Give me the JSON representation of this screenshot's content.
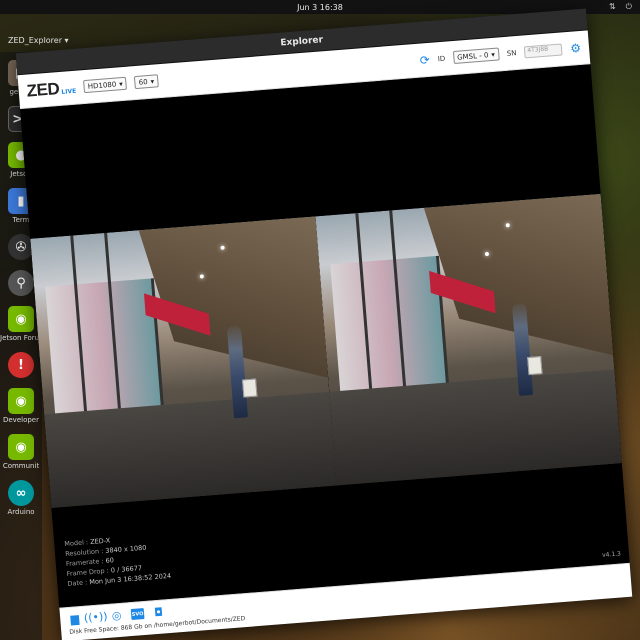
{
  "system": {
    "clock": "Jun 3  16:38",
    "app_menu": "ZED_Explorer"
  },
  "dock": {
    "items": [
      {
        "name": "files-icon",
        "label": "gerbot"
      },
      {
        "name": "terminal-icon",
        "label": ""
      },
      {
        "name": "jetson-icon",
        "label": "Jetson"
      },
      {
        "name": "settings-icon",
        "label": "Term"
      },
      {
        "name": "software-icon",
        "label": ""
      },
      {
        "name": "nvidia-icon",
        "label": "Jetson Forum"
      },
      {
        "name": "updates-icon",
        "label": ""
      },
      {
        "name": "developer-icon",
        "label": "Developer"
      },
      {
        "name": "community-icon",
        "label": "Communit"
      },
      {
        "name": "arduino-icon",
        "label": "Arduino"
      }
    ]
  },
  "window": {
    "title": "Explorer"
  },
  "toolbar": {
    "logo": "ZED",
    "logo_sub": "LIVE",
    "resolution": "HD1080",
    "fps": "60",
    "id_label": "ID",
    "input": "GMSL - 0",
    "sn_label": "SN",
    "sn_value": "4T3J8B"
  },
  "info": {
    "model_key": "Model :",
    "model": "ZED-X",
    "resolution_key": "Resolution :",
    "resolution": "3840 x 1080",
    "framerate_key": "Framerate :",
    "framerate": "60",
    "frame_drop_key": "Frame Drop :",
    "frame_drop": "0 / 36677",
    "date_key": "Date :",
    "date": "Mon Jun 3 16:38:52 2024"
  },
  "version": "v4.1.3",
  "bottom": {
    "disk_label": "Disk Free Space",
    "disk_value": "868 Gb",
    "disk_path": "on /home/gerbot/Documents/ZED"
  }
}
